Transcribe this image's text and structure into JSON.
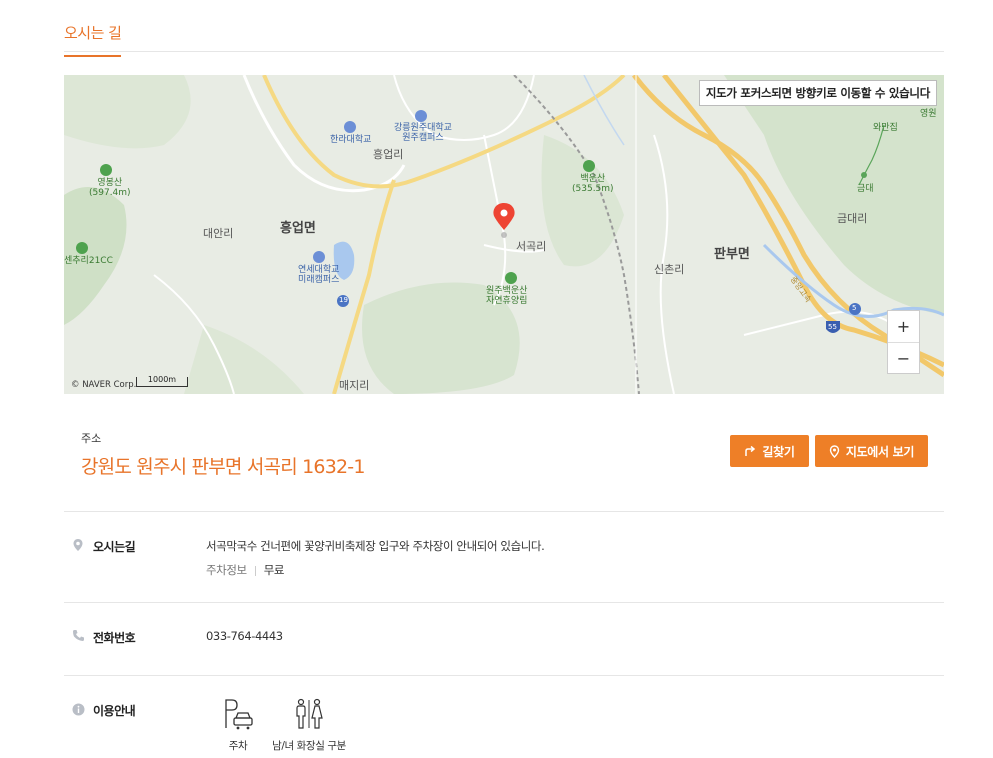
{
  "section": {
    "tab_label": "오시는 길"
  },
  "map": {
    "notice": "지도가 포커스되면 방향키로 이동할 수 있습니다",
    "copyright": "© NAVER Corp.",
    "scale": "1000m",
    "zoom_in": "+",
    "zoom_out": "−",
    "labels": {
      "heungeop_myeon": "흥업면",
      "heungeop_ri": "흥업리",
      "daean_ri": "대안리",
      "seogok_ri": "서곡리",
      "sinchon_ri": "신촌리",
      "panbu_myeon": "판부면",
      "geumdae_ri": "금대리",
      "maeji_ri": "매지리",
      "hallym_univ": "한라대학교",
      "gangneung_univ": "강릉원주대학교\n원주캠퍼스",
      "yonsei_univ": "연세대학교\n미래캠퍼스",
      "yeongbong_san": "영봉산\n(597.4m)",
      "baegun_san": "백운산\n(535.5m)",
      "forest": "원주백운산\n자연휴양림",
      "cc": "센추리21CC",
      "wanjip": "와만집",
      "geumdae": "금대",
      "yeongwon": "영원",
      "route_19": "19",
      "route_5": "5",
      "route_55": "55",
      "expressway": "중앙고속"
    }
  },
  "address": {
    "label": "주소",
    "value": "강원도 원주시 판부면 서곡리 1632-1",
    "route_button": "길찾기",
    "map_button": "지도에서 보기"
  },
  "directions": {
    "title": "오시는길",
    "text": "서곡막국수 건너편에 꽃양귀비축제장 입구와 주차장이 안내되어 있습니다.",
    "parking_label": "주차정보",
    "parking_value": "무료"
  },
  "phone": {
    "title": "전화번호",
    "value": "033-764-4443"
  },
  "facilities": {
    "title": "이용안내",
    "items": [
      {
        "label": "주차",
        "icon": "parking-icon"
      },
      {
        "label": "남/녀 화장실 구분",
        "icon": "restroom-icon"
      }
    ]
  },
  "colors": {
    "accent": "#e8742a",
    "button": "#ee7f27",
    "marker": "#ee4433"
  }
}
